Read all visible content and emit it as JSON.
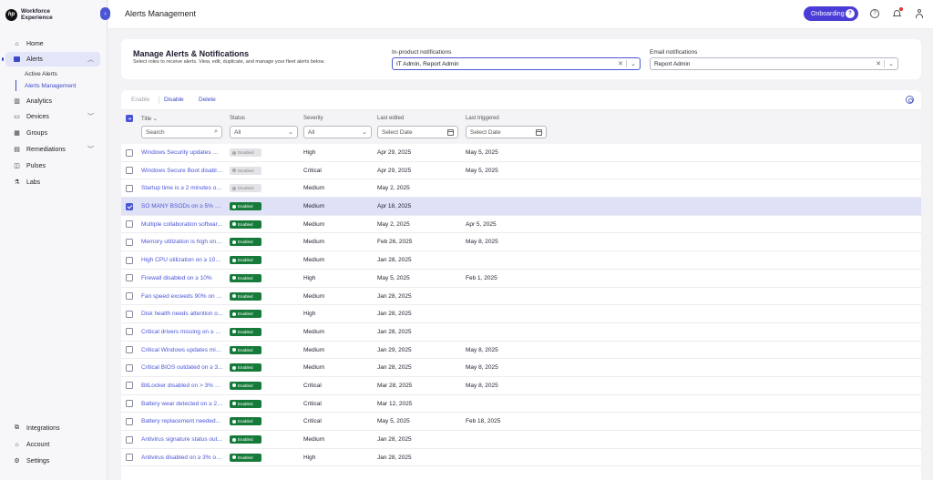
{
  "brand": {
    "logo": "hp",
    "name": "Workforce Experience"
  },
  "sidebar": {
    "items": [
      {
        "label": "Home",
        "icon": "home-icon"
      },
      {
        "label": "Alerts",
        "icon": "alerts-icon",
        "active": true,
        "expanded": true,
        "sub": [
          {
            "label": "Active Alerts"
          },
          {
            "label": "Alerts Management",
            "active": true
          }
        ]
      },
      {
        "label": "Analytics",
        "icon": "analytics-icon"
      },
      {
        "label": "Devices",
        "icon": "devices-icon"
      },
      {
        "label": "Groups",
        "icon": "groups-icon"
      },
      {
        "label": "Remediations",
        "icon": "remediations-icon"
      },
      {
        "label": "Pulses",
        "icon": "pulses-icon"
      },
      {
        "label": "Labs",
        "icon": "labs-icon"
      }
    ],
    "bottom": [
      {
        "label": "Integrations",
        "icon": "integrations-icon"
      },
      {
        "label": "Account",
        "icon": "account-icon"
      },
      {
        "label": "Settings",
        "icon": "settings-icon"
      }
    ]
  },
  "header": {
    "title": "Alerts Management",
    "onboarding_label": "Onboarding",
    "help": "?"
  },
  "manage": {
    "title": "Manage Alerts & Notifications",
    "subtitle": "Select roles to receive alerts. View, edit, duplicate, and manage your fleet alerts below.",
    "inproduct_label": "In-product notifications",
    "inproduct_value": "IT Admin, Report Admin",
    "email_label": "Email notifications",
    "email_value": "Report Admin"
  },
  "toolbar": {
    "enable": "Enable",
    "disable": "Disable",
    "delete": "Delete"
  },
  "table": {
    "columns": {
      "title": "Title",
      "status": "Status",
      "severity": "Severity",
      "last_edited": "Last edited",
      "last_triggered": "Last triggered"
    },
    "filters": {
      "search_placeholder": "Search",
      "status": "All",
      "severity": "All",
      "edited_placeholder": "Select Date",
      "triggered_placeholder": "Select Date"
    },
    "rows": [
      {
        "title": "Windows Security updates mi...",
        "status": "Disabled",
        "severity": "High",
        "last_edited": "Apr 29, 2025",
        "last_triggered": "May 5, 2025",
        "selected": false
      },
      {
        "title": "Windows Secure Boot disable...",
        "status": "Disabled",
        "severity": "Critical",
        "last_edited": "Apr 29, 2025",
        "last_triggered": "May 5, 2025",
        "selected": false
      },
      {
        "title": "Startup time is ≥ 2 minutes on ...",
        "status": "Disabled",
        "severity": "Medium",
        "last_edited": "May 2, 2025",
        "last_triggered": "",
        "selected": false
      },
      {
        "title": "SO MANY BSODs on ≥ 5% of d...",
        "status": "Enabled",
        "severity": "Medium",
        "last_edited": "Apr 18, 2025",
        "last_triggered": "",
        "selected": true
      },
      {
        "title": "Multiple collaboration softwar...",
        "status": "Enabled",
        "severity": "Medium",
        "last_edited": "May 2, 2025",
        "last_triggered": "Apr 5, 2025",
        "selected": false
      },
      {
        "title": "Memory utilization is high on ≥...",
        "status": "Enabled",
        "severity": "Medium",
        "last_edited": "Feb 26, 2025",
        "last_triggered": "May 8, 2025",
        "selected": false
      },
      {
        "title": "High CPU utilization on ≥ 10%...",
        "status": "Enabled",
        "severity": "Medium",
        "last_edited": "Jan 28, 2025",
        "last_triggered": "",
        "selected": false
      },
      {
        "title": "Firewall disabled on ≥ 10%",
        "status": "Enabled",
        "severity": "High",
        "last_edited": "May 5, 2025",
        "last_triggered": "Feb 1, 2025",
        "selected": false
      },
      {
        "title": "Fan speed exceeds 90% on ≥ ...",
        "status": "Enabled",
        "severity": "Medium",
        "last_edited": "Jan 28, 2025",
        "last_triggered": "",
        "selected": false
      },
      {
        "title": "Disk health needs attention o...",
        "status": "Enabled",
        "severity": "High",
        "last_edited": "Jan 28, 2025",
        "last_triggered": "",
        "selected": false
      },
      {
        "title": "Critical drivers missing on ≥ 1...",
        "status": "Enabled",
        "severity": "Medium",
        "last_edited": "Jan 28, 2025",
        "last_triggered": "",
        "selected": false
      },
      {
        "title": "Critical Windows updates mis...",
        "status": "Enabled",
        "severity": "Medium",
        "last_edited": "Jan 29, 2025",
        "last_triggered": "May 8, 2025",
        "selected": false
      },
      {
        "title": "Critical BIOS outdated on ≥ 3...",
        "status": "Enabled",
        "severity": "Medium",
        "last_edited": "Jan 28, 2025",
        "last_triggered": "May 8, 2025",
        "selected": false
      },
      {
        "title": "BitLocker disabled on > 3% of...",
        "status": "Enabled",
        "severity": "Critical",
        "last_edited": "Mar 28, 2025",
        "last_triggered": "May 8, 2025",
        "selected": false
      },
      {
        "title": "Battery wear detected on ≥ 20...",
        "status": "Enabled",
        "severity": "Critical",
        "last_edited": "Mar 12, 2025",
        "last_triggered": "",
        "selected": false
      },
      {
        "title": "Battery replacement needed...",
        "status": "Enabled",
        "severity": "Critical",
        "last_edited": "May 5, 2025",
        "last_triggered": "Feb 18, 2025",
        "selected": false
      },
      {
        "title": "Antivirus signature status out...",
        "status": "Enabled",
        "severity": "Medium",
        "last_edited": "Jan 28, 2025",
        "last_triggered": "",
        "selected": false
      },
      {
        "title": "Antivirus disabled on ≥ 3% of ...",
        "status": "Enabled",
        "severity": "High",
        "last_edited": "Jan 28, 2025",
        "last_triggered": "",
        "selected": false
      }
    ]
  },
  "colors": {
    "accent": "#4a56d6",
    "enabled": "#167a3a",
    "selected_row": "#dfe1f7"
  }
}
